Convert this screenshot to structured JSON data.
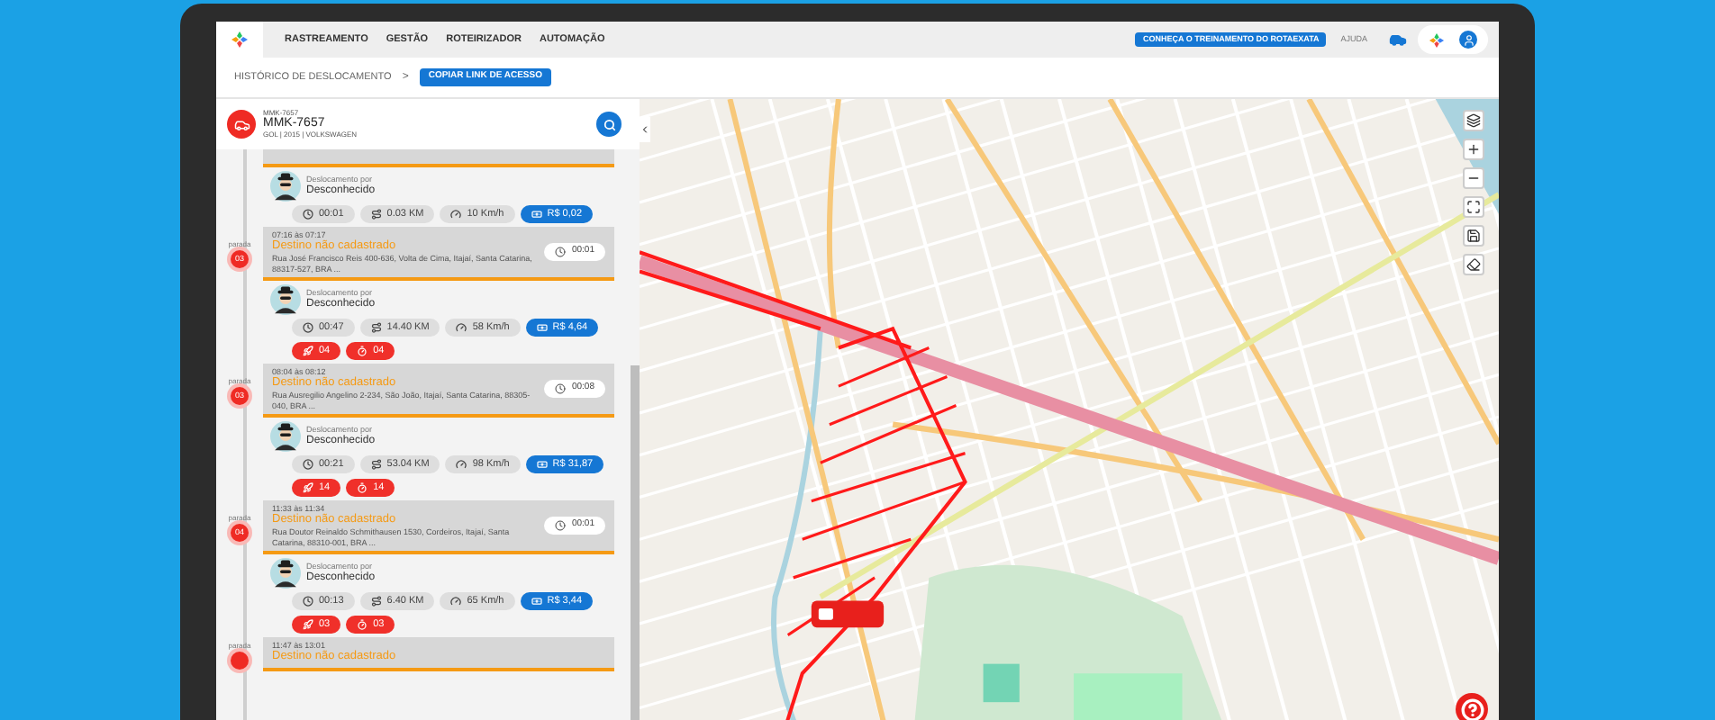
{
  "nav": {
    "tabs": [
      {
        "label": "RASTREAMENTO",
        "selected": false
      },
      {
        "label": "GESTÃO",
        "selected": false
      },
      {
        "label": "ROTEIRIZADOR",
        "selected": false
      },
      {
        "label": "AUTOMAÇÃO",
        "selected": false
      }
    ],
    "cta": "CONHEÇA O TREINAMENTO DO ROTAEXATA",
    "help": "AJUDA"
  },
  "breadcrumb": {
    "title": "HISTÓRICO DE DESLOCAMENTO",
    "separator": ">",
    "button": "COPIAR LINK DE ACESSO"
  },
  "vehicle": {
    "code": "MMK-7657",
    "plate": "MMK-7657",
    "details": "GOL | 2015 | VOLKSWAGEN"
  },
  "timeline": [
    {
      "kind": "stop_partial"
    },
    {
      "kind": "trip",
      "label": "Deslocamento por",
      "driver": "Desconhecido",
      "stats": [
        {
          "kind": "time",
          "text": "00:01"
        },
        {
          "kind": "distance",
          "text": "0.03 KM"
        },
        {
          "kind": "speed",
          "text": "10 Km/h"
        },
        {
          "kind": "cost",
          "text": "R$ 0,02"
        }
      ]
    },
    {
      "kind": "stop",
      "side": "parada",
      "number": "03",
      "time": "07:16 às 07:17",
      "title": "Destino não cadastrado",
      "address": "Rua José Francisco Reis 400-636, Volta de Cima, Itajaí, Santa Catarina, 88317-527, BRA ...",
      "duration": "00:01"
    },
    {
      "kind": "trip",
      "label": "Deslocamento por",
      "driver": "Desconhecido",
      "stats": [
        {
          "kind": "time",
          "text": "00:47"
        },
        {
          "kind": "distance",
          "text": "14.40 KM"
        },
        {
          "kind": "speed",
          "text": "58 Km/h"
        },
        {
          "kind": "cost",
          "text": "R$ 4,64"
        },
        {
          "kind": "alert",
          "text": "04"
        },
        {
          "kind": "timer",
          "text": "04"
        }
      ]
    },
    {
      "kind": "stop",
      "side": "parada",
      "number": "03",
      "time": "08:04 às 08:12",
      "title": "Destino não cadastrado",
      "address": "Rua Ausregilio Angelino 2-234, São João, Itajaí, Santa Catarina, 88305-040, BRA ...",
      "duration": "00:08"
    },
    {
      "kind": "trip",
      "label": "Deslocamento por",
      "driver": "Desconhecido",
      "stats": [
        {
          "kind": "time",
          "text": "00:21"
        },
        {
          "kind": "distance",
          "text": "53.04 KM"
        },
        {
          "kind": "speed",
          "text": "98 Km/h"
        },
        {
          "kind": "cost",
          "text": "R$ 31,87"
        },
        {
          "kind": "alert",
          "text": "14"
        },
        {
          "kind": "timer",
          "text": "14"
        }
      ]
    },
    {
      "kind": "stop",
      "side": "parada",
      "number": "04",
      "time": "11:33 às 11:34",
      "title": "Destino não cadastrado",
      "address": "Rua Doutor Reinaldo Schmithausen 1530, Cordeiros, Itajaí, Santa Catarina, 88310-001, BRA ...",
      "duration": "00:01"
    },
    {
      "kind": "trip",
      "label": "Deslocamento por",
      "driver": "Desconhecido",
      "stats": [
        {
          "kind": "time",
          "text": "00:13"
        },
        {
          "kind": "distance",
          "text": "6.40 KM"
        },
        {
          "kind": "speed",
          "text": "65 Km/h"
        },
        {
          "kind": "cost",
          "text": "R$ 3,44"
        },
        {
          "kind": "alert",
          "text": "03"
        },
        {
          "kind": "timer",
          "text": "03"
        }
      ]
    },
    {
      "kind": "stop",
      "side": "parada",
      "time": "11:47 às 13:01",
      "title": "Destino não cadastrado"
    }
  ]
}
